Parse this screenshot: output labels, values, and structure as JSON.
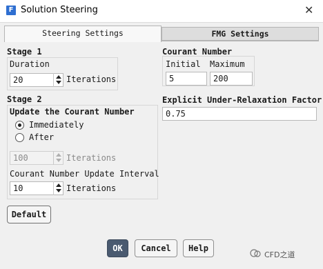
{
  "window": {
    "title": "Solution Steering",
    "app_icon_letter": "F"
  },
  "tabs": [
    {
      "label": "Steering Settings",
      "active": true
    },
    {
      "label": "FMG Settings",
      "active": false
    }
  ],
  "stage1": {
    "heading": "Stage 1",
    "duration_label": "Duration",
    "duration_value": "20",
    "duration_unit": "Iterations"
  },
  "courant": {
    "heading": "Courant Number",
    "initial_label": "Initial",
    "initial_value": "5",
    "maximum_label": "Maximum",
    "maximum_value": "200"
  },
  "stage2": {
    "heading": "Stage 2",
    "update_heading": "Update the Courant Number",
    "options": [
      {
        "label": "Immediately",
        "selected": true
      },
      {
        "label": "After",
        "selected": false
      }
    ],
    "after_value": "100",
    "after_unit": "Iterations",
    "interval_label": "Courant Number Update Interval",
    "interval_value": "10",
    "interval_unit": "Iterations"
  },
  "explicit": {
    "label": "Explicit Under-Relaxation Factor",
    "value": "0.75"
  },
  "buttons": {
    "default_label": "Default",
    "ok_label": "OK",
    "cancel_label": "Cancel",
    "help_label": "Help"
  },
  "watermark": {
    "text": "CFD之道"
  },
  "colors": {
    "accent": "#4a5a70",
    "app_icon": "#2f6fd1"
  }
}
